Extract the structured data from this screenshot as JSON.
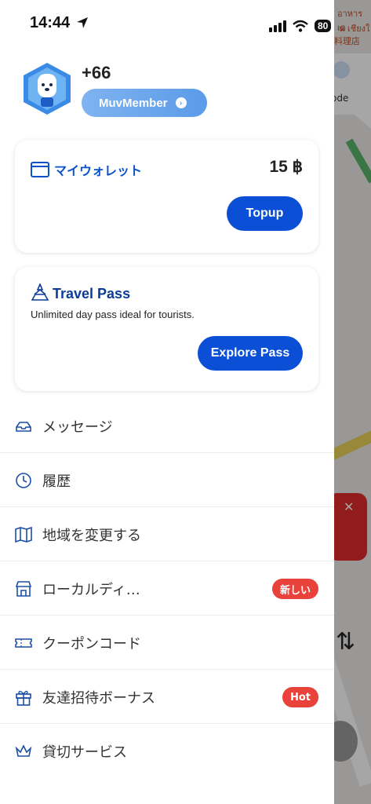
{
  "status_bar": {
    "time": "14:44",
    "battery": "80"
  },
  "map": {
    "text_1": "อาหารเด",
    "text_2": "น เชียงใ",
    "text_3": "料理店",
    "code_label": "ode"
  },
  "profile": {
    "phone": "+66",
    "member_label": "MuvMember"
  },
  "wallet": {
    "title": "マイウォレット",
    "amount": "15 ฿",
    "topup_label": "Topup"
  },
  "travel_pass": {
    "title": "Travel Pass",
    "subtitle": "Unlimited day pass ideal for tourists.",
    "button_label": "Explore Pass"
  },
  "menu": {
    "items": [
      {
        "label": "メッセージ",
        "icon": "inbox-icon"
      },
      {
        "label": "履歴",
        "icon": "history-icon"
      },
      {
        "label": "地域を変更する",
        "icon": "map-icon"
      },
      {
        "label": "ローカルディ…",
        "icon": "store-icon",
        "badge": "新しい"
      },
      {
        "label": "クーポンコード",
        "icon": "ticket-icon"
      },
      {
        "label": "友達招待ボーナス",
        "icon": "gift-icon",
        "badge": "Hot"
      },
      {
        "label": "貸切サービス",
        "icon": "crown-icon"
      }
    ]
  },
  "colors": {
    "primary": "#0a4fd6",
    "accent_light": "#5b9be8",
    "badge_red": "#e8423b"
  }
}
